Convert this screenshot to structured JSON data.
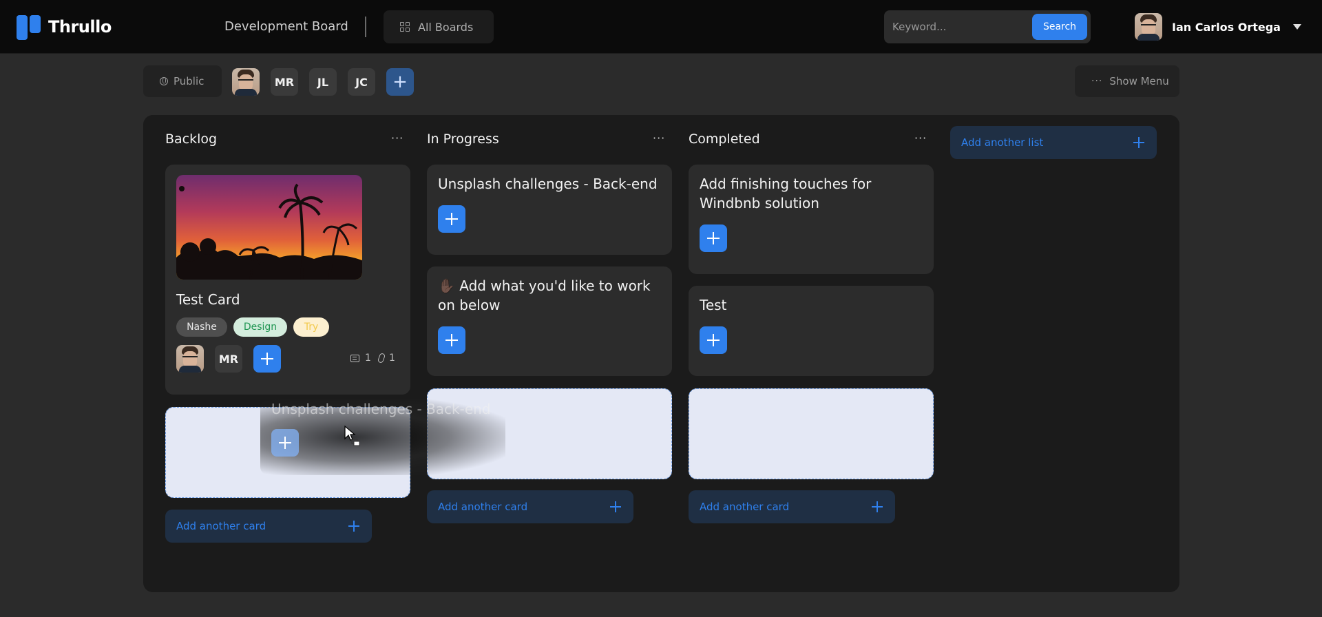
{
  "app": {
    "name": "Thrullo"
  },
  "header": {
    "board_title": "Development Board",
    "all_boards_label": "All Boards",
    "search_placeholder": "Keyword...",
    "search_button": "Search",
    "user_name": "Ian Carlos Ortega"
  },
  "subbar": {
    "visibility_label": "Public",
    "members": [
      "MR",
      "JL",
      "JC"
    ],
    "show_menu_label": "Show Menu"
  },
  "lists": [
    {
      "title": "Backlog",
      "cards": [
        {
          "title": "Test Card",
          "labels": [
            {
              "text": "Nashe",
              "bg": "#4f4f4f",
              "color": "#e8e8e8"
            },
            {
              "text": "Design",
              "bg": "#d4eddd",
              "color": "#219653"
            },
            {
              "text": "Try",
              "bg": "#fdf0d0",
              "color": "#f2c94c"
            }
          ],
          "member_initials": "MR",
          "comments": "1",
          "attachments": "1"
        }
      ],
      "add_card_label": "Add another card"
    },
    {
      "title": "In Progress",
      "cards": [
        {
          "title": "Unsplash challenges - Back-end"
        },
        {
          "title": "✋🏿 Add what you'd like to work on below"
        }
      ],
      "add_card_label": "Add another card"
    },
    {
      "title": "Completed",
      "cards": [
        {
          "title": "Add finishing touches for Windbnb solution"
        },
        {
          "title": "Test"
        }
      ],
      "add_card_label": "Add another card"
    }
  ],
  "add_list_label": "Add another list",
  "drag_ghost": {
    "title": "Unsplash challenges - Back-end"
  },
  "colors": {
    "accent": "#2f80ed",
    "board_bg": "#1b1b1b",
    "card_bg": "#2c2c2c"
  }
}
